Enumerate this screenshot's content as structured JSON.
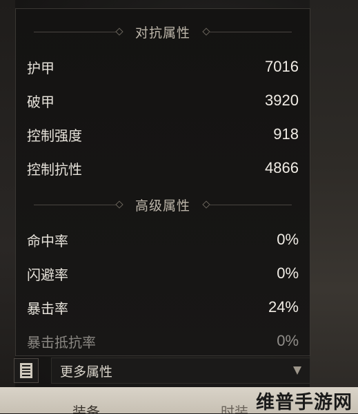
{
  "sections": [
    {
      "title": "对抗属性",
      "stats": [
        {
          "label": "护甲",
          "value": "7016"
        },
        {
          "label": "破甲",
          "value": "3920"
        },
        {
          "label": "控制强度",
          "value": "918"
        },
        {
          "label": "控制抗性",
          "value": "4866"
        }
      ]
    },
    {
      "title": "高级属性",
      "stats": [
        {
          "label": "命中率",
          "value": "0%"
        },
        {
          "label": "闪避率",
          "value": "0%"
        },
        {
          "label": "暴击率",
          "value": "24%"
        },
        {
          "label": "暴击抵抗率",
          "value": "0%"
        }
      ]
    }
  ],
  "more": {
    "label": "更多属性"
  },
  "tabs": [
    {
      "label": "装备"
    },
    {
      "label": "时装"
    }
  ],
  "watermark": "维普手游网",
  "icons": {
    "more_icon": "list-book-icon",
    "dropdown": "chevron-down-icon"
  }
}
